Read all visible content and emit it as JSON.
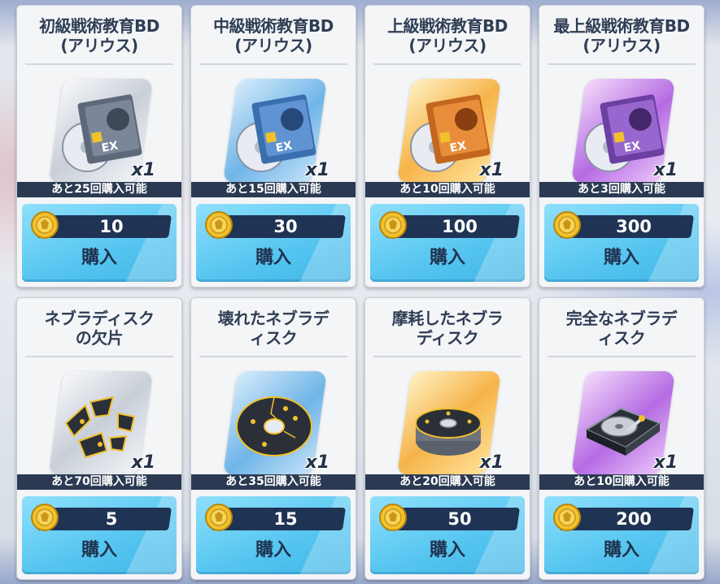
{
  "shop": {
    "items": [
      {
        "title": "初級戦術教育BD\n(アリウス)",
        "quantity": "x1",
        "limit": "あと25回購入可能",
        "price": "10",
        "buy_label": "購入",
        "rarity": "gray",
        "icon": "bd-disc-tier1-icon",
        "tier": "1"
      },
      {
        "title": "中級戦術教育BD\n(アリウス)",
        "quantity": "x1",
        "limit": "あと15回購入可能",
        "price": "30",
        "buy_label": "購入",
        "rarity": "blue",
        "icon": "bd-disc-tier2-icon",
        "tier": "2"
      },
      {
        "title": "上級戦術教育BD\n(アリウス)",
        "quantity": "x1",
        "limit": "あと10回購入可能",
        "price": "100",
        "buy_label": "購入",
        "rarity": "gold",
        "icon": "bd-disc-tier3-icon",
        "tier": "3"
      },
      {
        "title": "最上級戦術教育BD\n(アリウス)",
        "quantity": "x1",
        "limit": "あと3回購入可能",
        "price": "300",
        "buy_label": "購入",
        "rarity": "purple",
        "icon": "bd-disc-tier4-icon",
        "tier": "4"
      },
      {
        "title": "ネブラディスク\nの欠片",
        "quantity": "x1",
        "limit": "あと70回購入可能",
        "price": "5",
        "buy_label": "購入",
        "rarity": "gray",
        "icon": "disc-fragment-icon"
      },
      {
        "title": "壊れたネブラデ\nィスク",
        "quantity": "x1",
        "limit": "あと35回購入可能",
        "price": "15",
        "buy_label": "購入",
        "rarity": "blue",
        "icon": "broken-disc-icon"
      },
      {
        "title": "摩耗したネブラ\nディスク",
        "quantity": "x1",
        "limit": "あと20回購入可能",
        "price": "50",
        "buy_label": "購入",
        "rarity": "gold",
        "icon": "worn-disc-icon"
      },
      {
        "title": "完全なネブラデ\nィスク",
        "quantity": "x1",
        "limit": "あと10回購入可能",
        "price": "200",
        "buy_label": "購入",
        "rarity": "purple",
        "icon": "hard-drive-icon"
      }
    ],
    "currency_icon": "arius-coin-icon",
    "colors": {
      "title_text": "#2f3e55",
      "limit_bar": "#2b3a52",
      "price_bar": "#1f3354",
      "buy_button": "#55c5f0",
      "coin": "#f2c12e"
    }
  }
}
